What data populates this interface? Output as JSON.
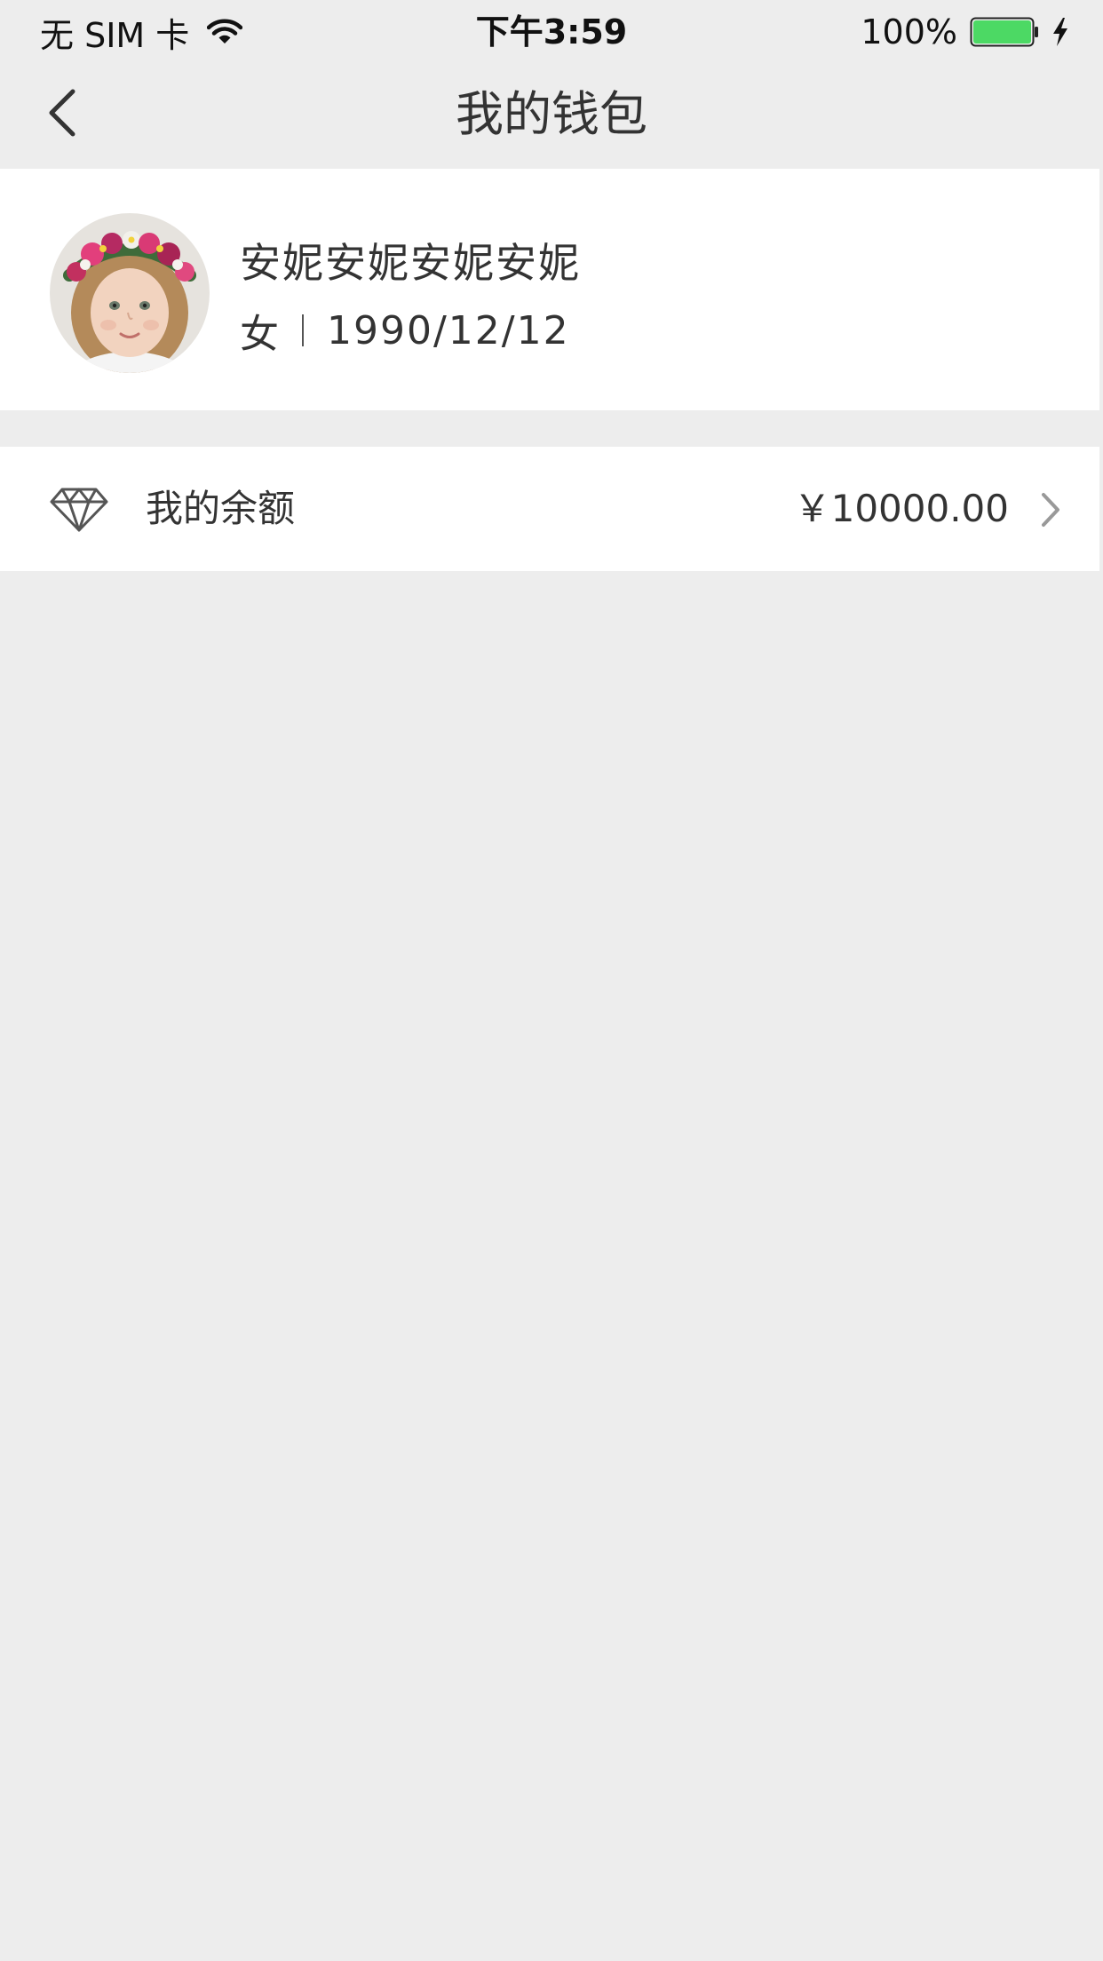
{
  "status_bar": {
    "carrier": "无 SIM 卡",
    "time": "下午3:59",
    "battery_percent": "100%",
    "battery_level": 1.0,
    "battery_color": "#4cd964",
    "icons": [
      "wifi-icon",
      "battery-icon",
      "charging-bolt-icon"
    ]
  },
  "nav": {
    "title": "我的钱包",
    "back_icon": "chevron-left-icon"
  },
  "profile": {
    "name": "安妮安妮安妮安妮",
    "gender": "女",
    "birthday": "1990/12/12",
    "avatar": "avatar-photo"
  },
  "balance": {
    "icon": "diamond-icon",
    "label": "我的余额",
    "amount": "￥10000.00",
    "chevron_icon": "chevron-right-icon"
  },
  "colors": {
    "background": "#ededed",
    "card": "#ffffff",
    "text": "#333333"
  }
}
